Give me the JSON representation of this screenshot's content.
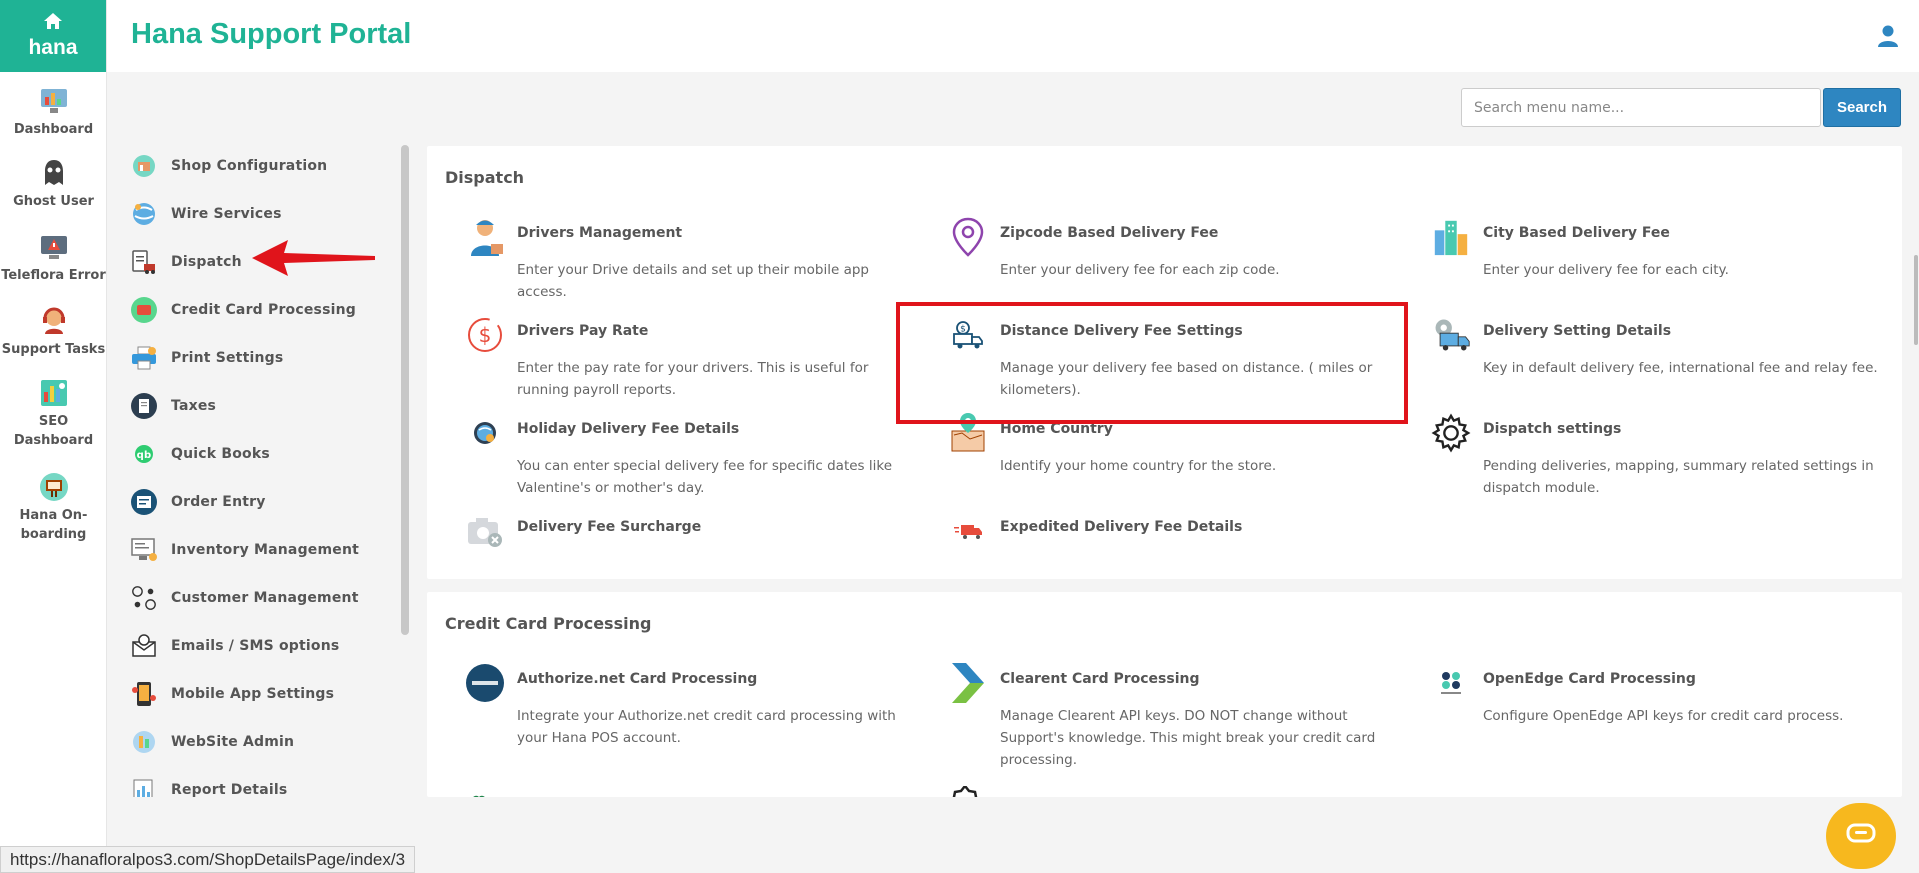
{
  "app": {
    "logo_word": "hana",
    "title": "Hana Support Portal"
  },
  "rail": {
    "items": [
      {
        "label": "Dashboard"
      },
      {
        "label": "Ghost User"
      },
      {
        "label": "Teleflora Error"
      },
      {
        "label": "Support Tasks"
      },
      {
        "label": "SEO Dashboard"
      },
      {
        "label": "Hana On-boarding"
      }
    ]
  },
  "search": {
    "placeholder": "Search menu name...",
    "button_label": "Search"
  },
  "menu": {
    "items": [
      {
        "label": "Shop Configuration"
      },
      {
        "label": "Wire Services"
      },
      {
        "label": "Dispatch"
      },
      {
        "label": "Credit Card Processing"
      },
      {
        "label": "Print Settings"
      },
      {
        "label": "Taxes"
      },
      {
        "label": "Quick Books"
      },
      {
        "label": "Order Entry"
      },
      {
        "label": "Inventory Management"
      },
      {
        "label": "Customer Management"
      },
      {
        "label": "Emails / SMS options"
      },
      {
        "label": "Mobile App Settings"
      },
      {
        "label": "WebSite Admin"
      },
      {
        "label": "Report Details"
      }
    ]
  },
  "dispatch": {
    "title": "Dispatch",
    "entries": [
      {
        "name": "Drivers Management",
        "desc": "Enter your Drive details and set up their mobile app access."
      },
      {
        "name": "Zipcode Based Delivery Fee",
        "desc": "Enter your delivery fee for each zip code."
      },
      {
        "name": "City Based Delivery Fee",
        "desc": "Enter your delivery fee for each city."
      },
      {
        "name": "Drivers Pay Rate",
        "desc": "Enter the pay rate for your drivers. This is useful for running payroll reports."
      },
      {
        "name": "Distance Delivery Fee Settings",
        "desc": "Manage your delivery fee based on distance. ( miles or kilometers)."
      },
      {
        "name": "Delivery Setting Details",
        "desc": "Key in default delivery fee, international fee and relay fee."
      },
      {
        "name": "Holiday Delivery Fee Details",
        "desc": "You can enter special delivery fee for specific dates like Valentine's or mother's day."
      },
      {
        "name": "Home Country",
        "desc": "Identify your home country for the store."
      },
      {
        "name": "Dispatch settings",
        "desc": "Pending deliveries, mapping, summary related settings in dispatch module."
      },
      {
        "name": "Delivery Fee Surcharge",
        "desc": ""
      },
      {
        "name": "Expedited Delivery Fee Details",
        "desc": ""
      }
    ]
  },
  "credit": {
    "title": "Credit Card Processing",
    "entries": [
      {
        "name": "Authorize.net Card Processing",
        "desc": "Integrate your Authorize.net credit card processing with your Hana POS account."
      },
      {
        "name": "Clearent Card Processing",
        "desc": "Manage Clearent API keys. DO NOT change without Support's knowledge. This might break your credit card processing."
      },
      {
        "name": "OpenEdge Card Processing",
        "desc": "Configure OpenEdge API keys for credit card process."
      }
    ]
  },
  "status_bar": {
    "url": "https://hanafloralpos3.com/ShopDetailsPage/index/3"
  },
  "colors": {
    "brand_teal": "#1fb395",
    "search_blue": "#2e86c1",
    "highlight_red": "#e0141b",
    "chat_yellow": "#f7b81e"
  }
}
